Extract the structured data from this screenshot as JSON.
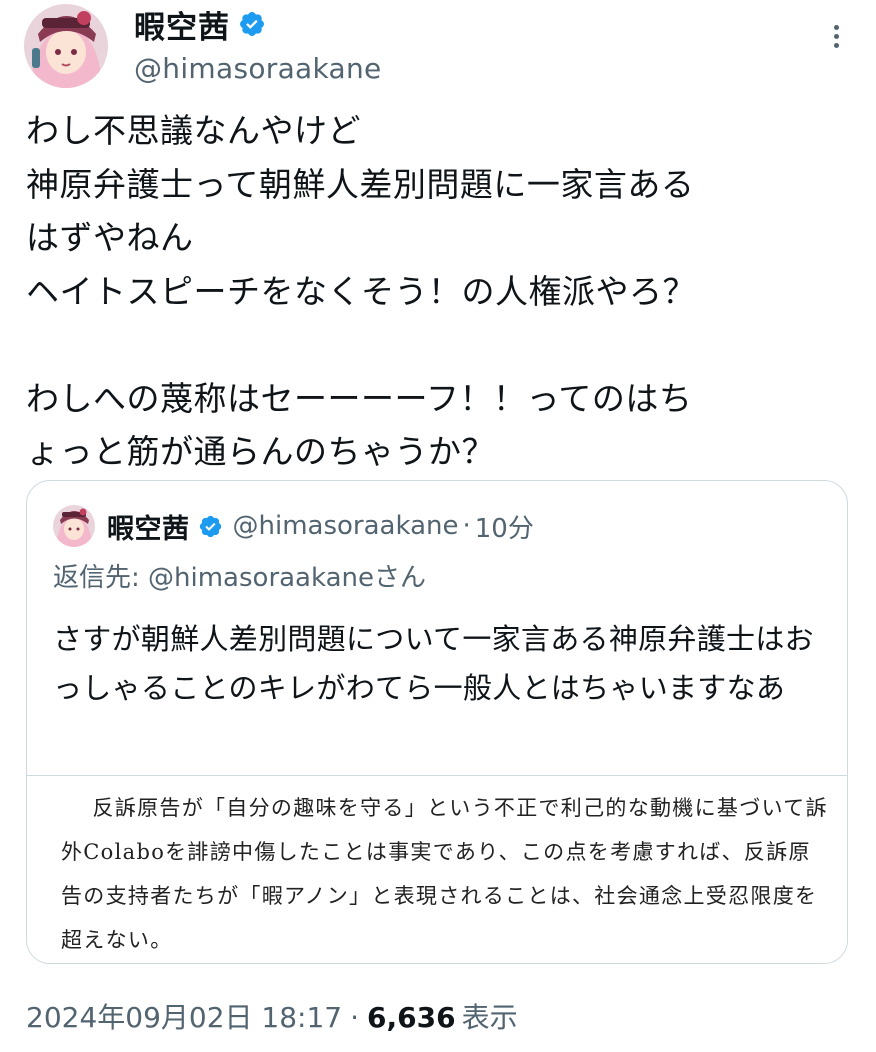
{
  "tweet": {
    "author": {
      "display_name": "暇空茜",
      "handle": "@himasoraakane",
      "verified": true
    },
    "text": "わし不思議なんやけど\n神原弁護士って朝鮮人差別問題に一家言ある\nはずやねん\nヘイトスピーチをなくそう！の人権派やろ？\n\nわしへの蔑称はセーーーーフ！！ってのはち\nょっと筋が通らんのちゃうか？",
    "quoted": {
      "display_name": "暇空茜",
      "handle": "@himasoraakane",
      "separator": "·",
      "time": "10分",
      "reply_to": "返信先: @himasoraakaneさん",
      "text": "さすが朝鮮人差別問題について一家言ある神原弁護士はおっしゃることのキレがわてら一般人とはちゃいますなあ",
      "image_text": "反訴原告が「自分の趣味を守る」という不正で利己的な動機に基づいて訴外Colaboを誹謗中傷したことは事実であり、この点を考慮すれば、反訴原告の支持者たちが「暇アノン」と表現されることは、社会通念上受忍限度を超えない。"
    },
    "timestamp": "2024年09月02日 18:17",
    "separator": "·",
    "views_count": "6,636",
    "views_label": "表示"
  },
  "icons": {
    "verified": "verified-badge-icon",
    "more": "more-vertical-icon"
  },
  "colors": {
    "verified_blue": "#1d9bf0",
    "text_primary": "#0f1419",
    "text_secondary": "#536471",
    "border": "#cfd9de"
  }
}
